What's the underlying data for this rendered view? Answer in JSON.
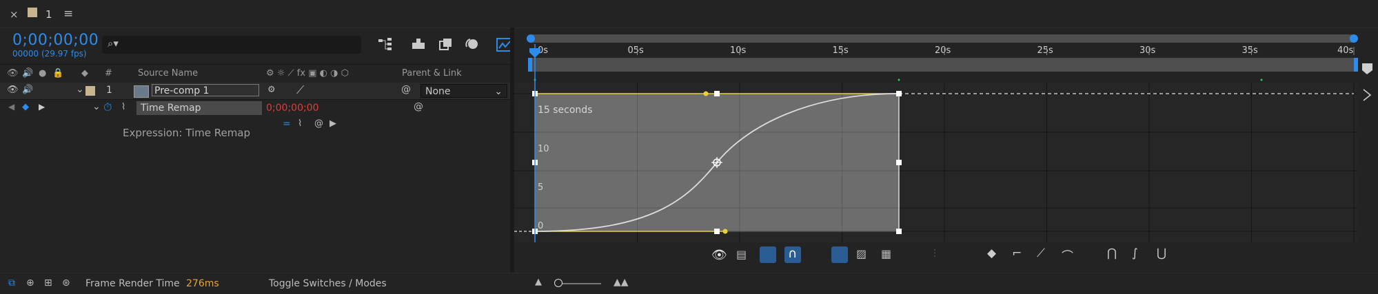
{
  "tab": {
    "title": "1",
    "close_icon": "×",
    "menu_icon": "≡",
    "swatch_color": "#c9b490"
  },
  "timecode": {
    "value": "0;00;00;00",
    "frame_info": "00000 (29.97 fps)"
  },
  "search": {
    "placeholder": "",
    "icon": "search-icon"
  },
  "columns": {
    "number": "#",
    "source_name": "Source Name",
    "parent_link": "Parent & Link"
  },
  "layer": {
    "index": "1",
    "name": "Pre-comp 1",
    "parent": "None"
  },
  "property": {
    "name": "Time Remap",
    "value": "0;00;00;00"
  },
  "expression": {
    "label": "Expression: Time Remap"
  },
  "ruler": {
    "ticks": [
      "0s",
      "05s",
      "10s",
      "15s",
      "20s",
      "25s",
      "30s",
      "35s",
      "40s"
    ]
  },
  "graph": {
    "unit_label": "15 seconds",
    "y_labels": [
      "10",
      "5",
      "0"
    ],
    "curve_color": "#d8d8d8",
    "handle_color": "#e8d23a",
    "accent_color": "#2d8ceb"
  },
  "status": {
    "frame_render_label": "Frame Render Time",
    "frame_render_value": "276ms",
    "toggle_label": "Toggle Switches / Modes"
  }
}
